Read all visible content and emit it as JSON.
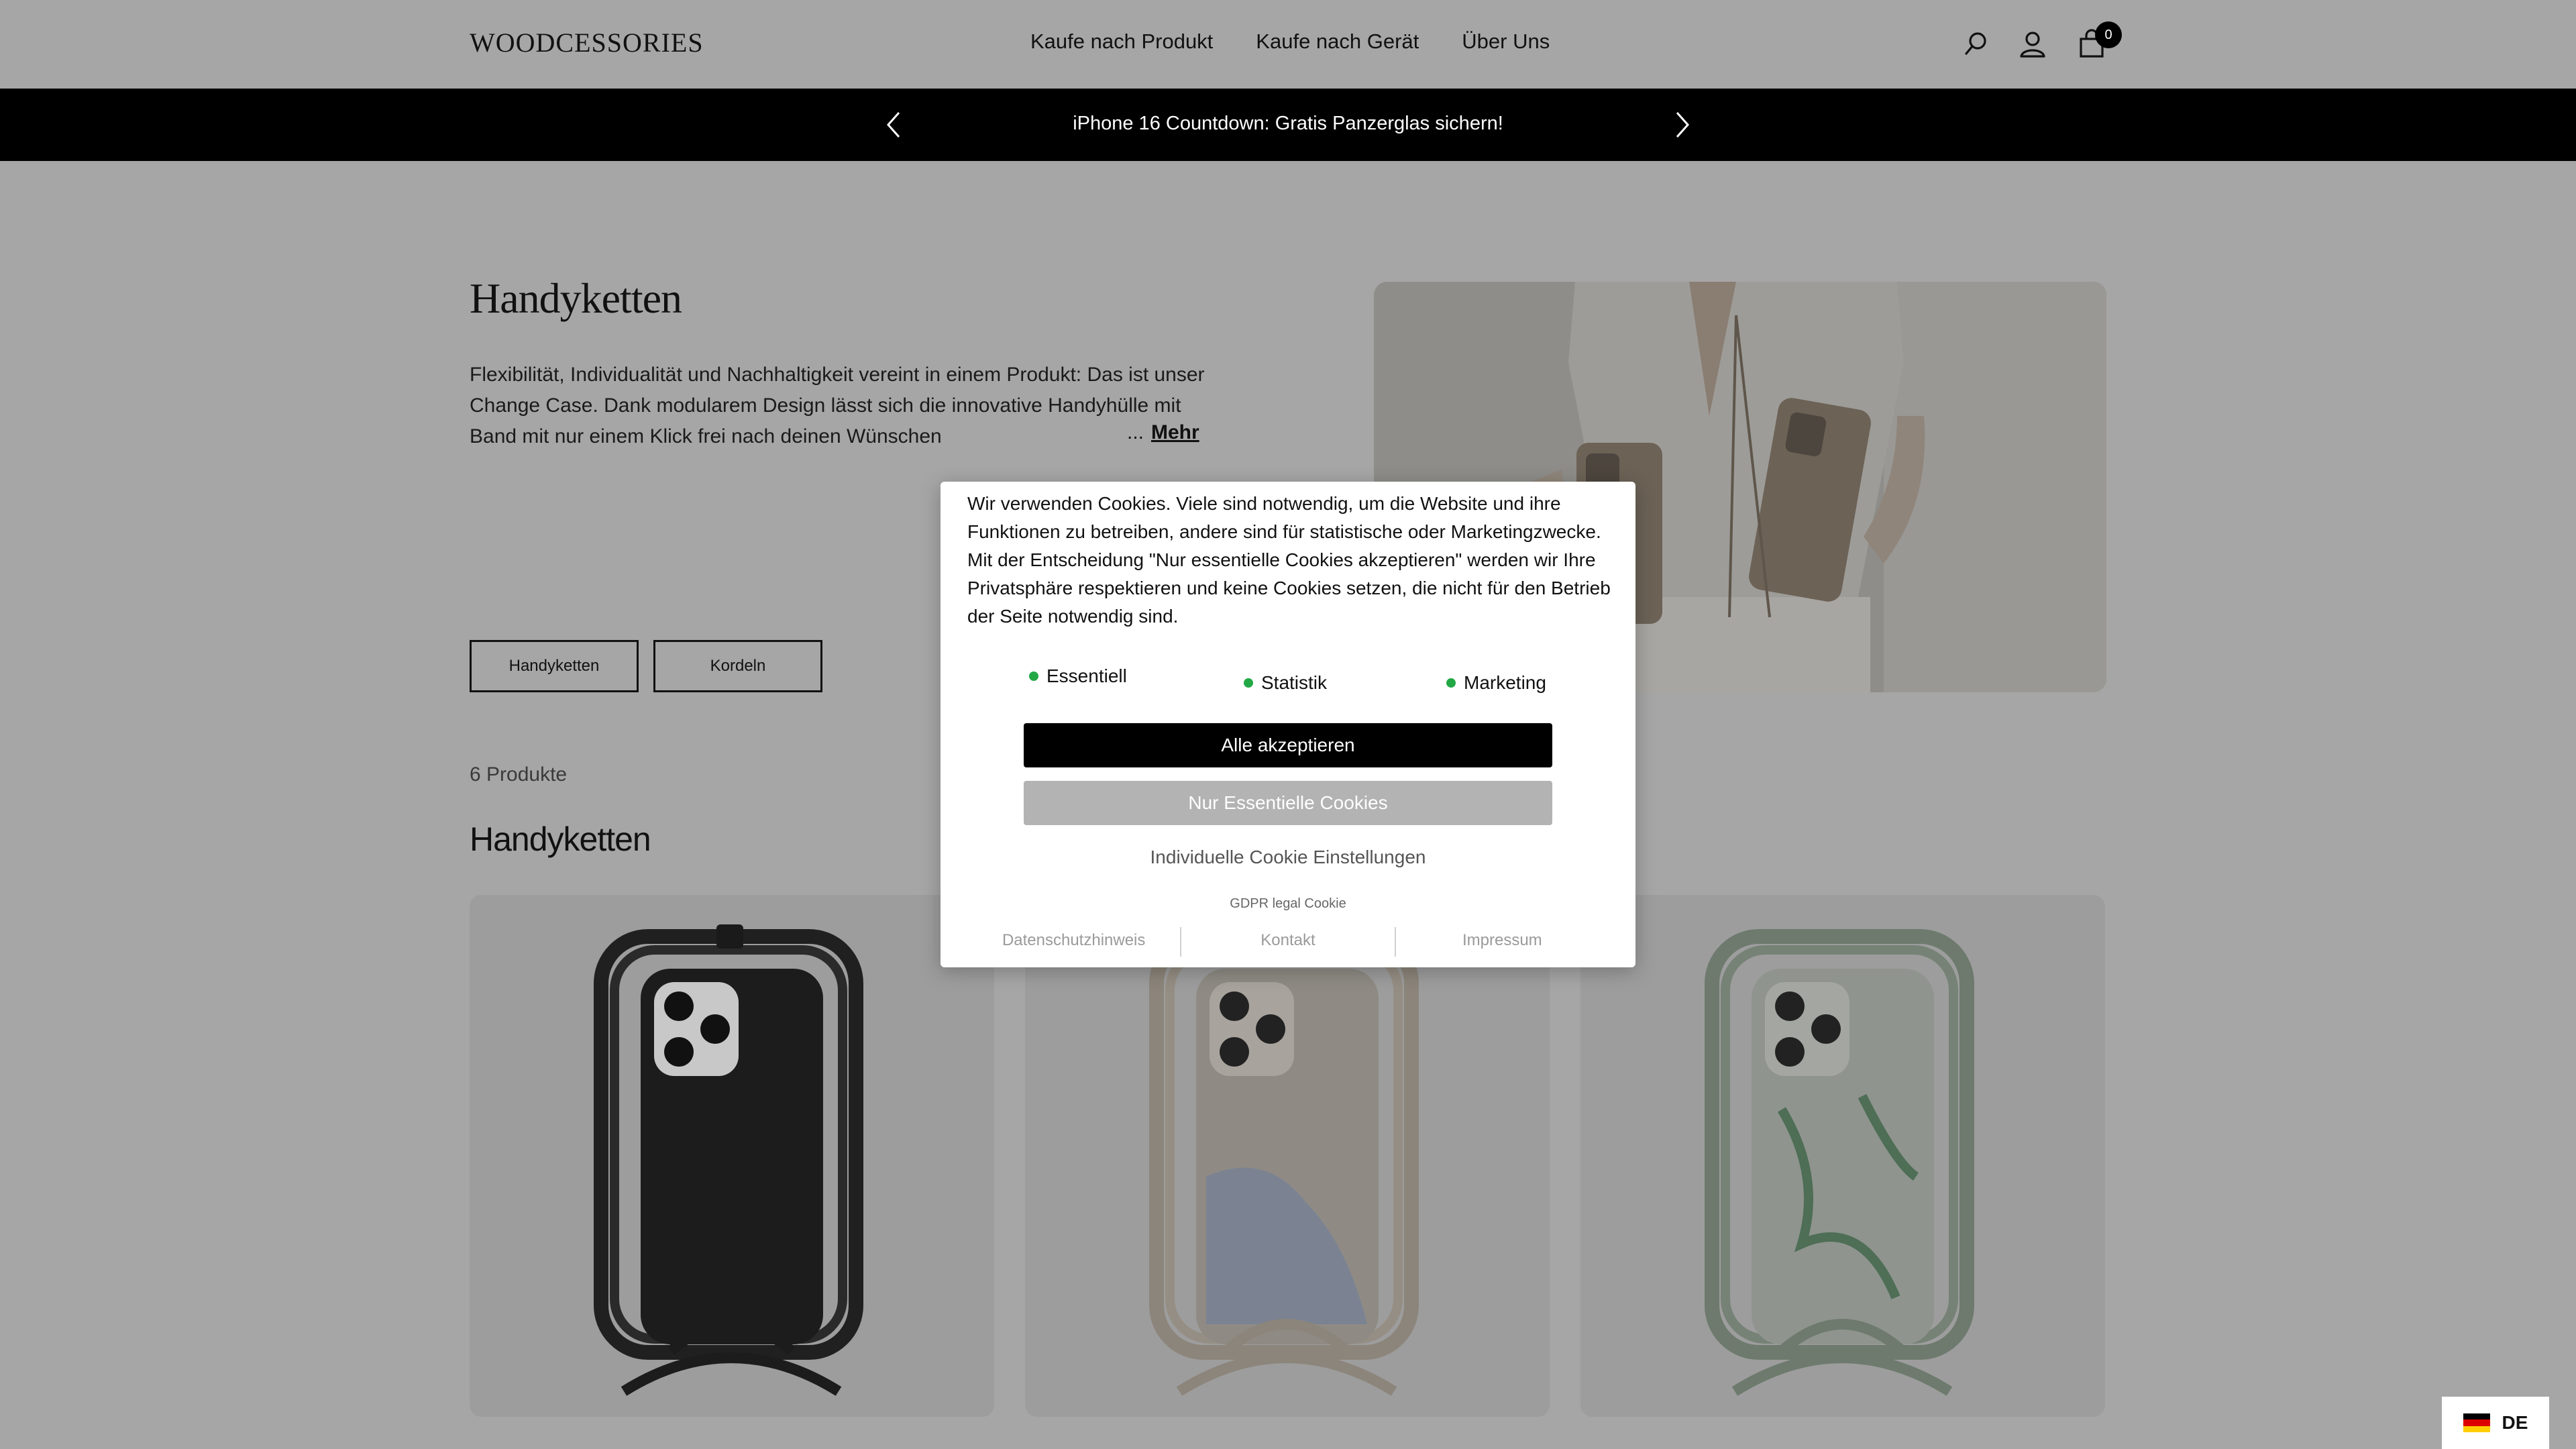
{
  "header": {
    "logo": "WOODCESSORIES",
    "nav": [
      "Kaufe nach Produkt",
      "Kaufe nach Gerät",
      "Über Uns"
    ],
    "cart_count": "0",
    "icons": [
      "search-icon",
      "user-icon",
      "cart-icon"
    ]
  },
  "announcement": {
    "text": "iPhone 16 Countdown: Gratis Panzerglas sichern!"
  },
  "hero": {
    "title": "Handyketten",
    "description": "Flexibilität, Individualität und Nachhaltigkeit vereint in einem Produkt: Das ist unser Change Case. Dank modularem Design lässt sich die innovative Handyhülle mit Band mit nur einem Klick frei nach deinen Wünschen",
    "ellipsis": "...",
    "more": "Mehr",
    "filters": [
      "Handyketten",
      "Kordeln"
    ]
  },
  "products": {
    "count": "6 Produkte",
    "heading": "Handyketten",
    "cards": [
      {
        "color": "black"
      },
      {
        "color": "beige-blue watercolor"
      },
      {
        "color": "sage green marble"
      }
    ]
  },
  "cookie": {
    "text": "Wir verwenden Cookies. Viele sind notwendig, um die Website und ihre Funktionen zu betreiben, andere sind für statistische oder Marketingzwecke. Mit der Entscheidung \"Nur essentielle Cookies akzeptieren\" werden wir Ihre Privatsphäre respektieren und keine Cookies setzen, die nicht für den Betrieb der Seite notwendig sind.",
    "categories": [
      "Essentiell",
      "Statistik",
      "Marketing"
    ],
    "accept_all": "Alle akzeptieren",
    "essential_only": "Nur Essentielle Cookies",
    "individual": "Individuelle Cookie Einstellungen",
    "gdpr": "GDPR legal Cookie",
    "links": [
      "Datenschutzhinweis",
      "Kontakt",
      "Impressum"
    ]
  },
  "language": {
    "code": "DE"
  }
}
